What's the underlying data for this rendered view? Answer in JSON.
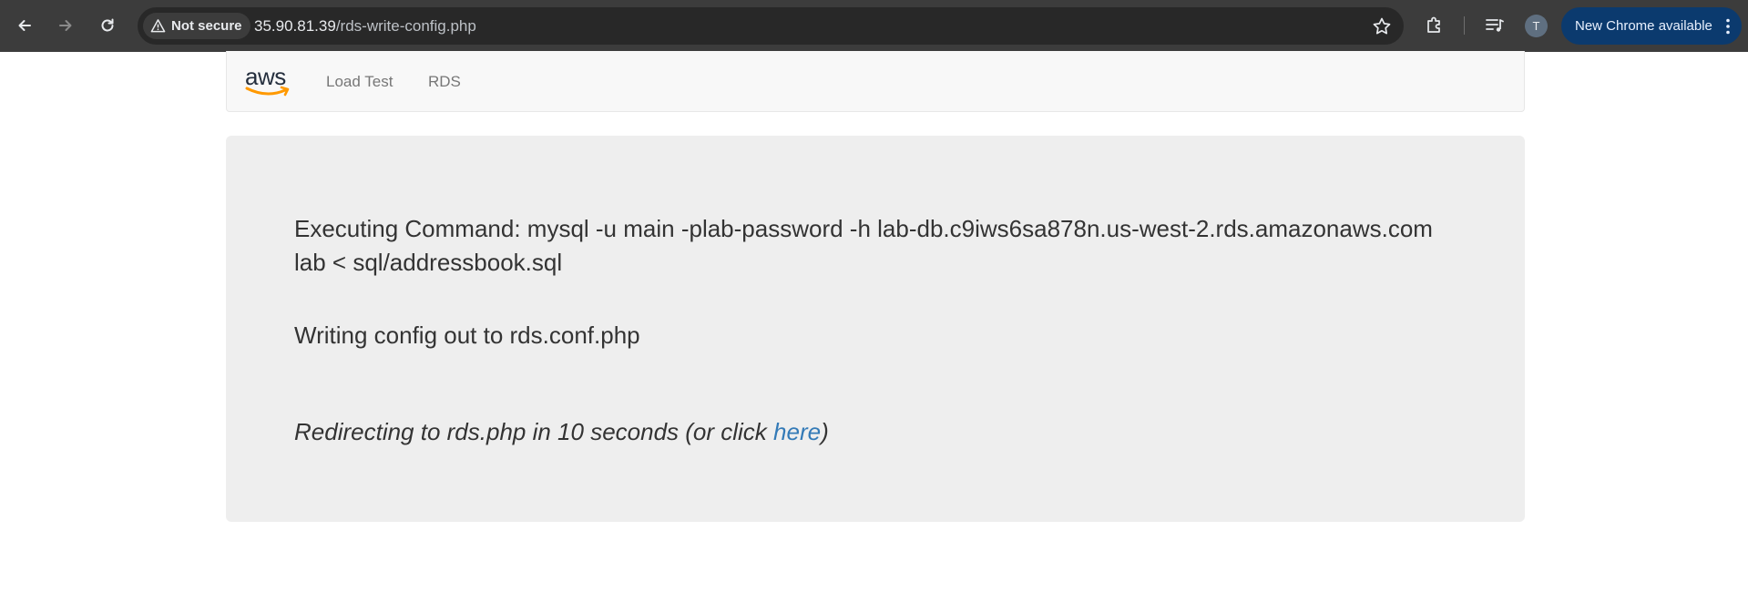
{
  "browser": {
    "security_label": "Not secure",
    "url_host": "35.90.81.39",
    "url_path": "/rds-write-config.php",
    "profile_initial": "T",
    "update_label": "New Chrome available",
    "colors": {
      "toolbar": "#3c3c3c",
      "omnibox": "#282828",
      "update_chip": "#0b3a6e"
    }
  },
  "navbar": {
    "logo_text": "aws",
    "links": [
      "Load Test",
      "RDS"
    ]
  },
  "content": {
    "command_line1": "Executing Command: mysql -u main -plab-password -h lab-db.c9iws6sa878n.us-west-2.rds.amazonaws.com",
    "command_line2": "lab < sql/addressbook.sql",
    "writing_config": "Writing config out to rds.conf.php",
    "redirect_prefix": "Redirecting to rds.php in 10 seconds (or click ",
    "redirect_link": "here",
    "redirect_suffix": ")",
    "link_color": "#337ab7"
  }
}
